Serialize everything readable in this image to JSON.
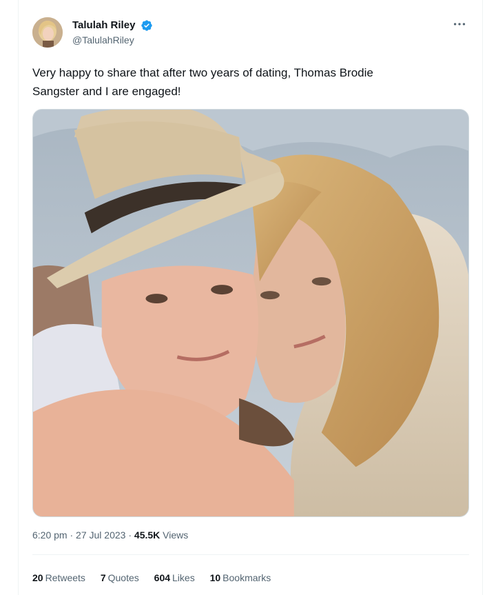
{
  "tweet": {
    "author": {
      "display_name": "Talulah Riley",
      "handle": "@TalulahRiley",
      "verified": true,
      "avatar_icon": "avatar-photo"
    },
    "more_icon": "more-options-icon",
    "text_line_1": "Very happy to share that after two years of dating, Thomas Brodie",
    "text_line_2": "Sangster and I are engaged!",
    "media": {
      "type": "photo",
      "description_icon": "couple-selfie-photo"
    },
    "meta": {
      "time": "6:20 pm",
      "separator_1": "·",
      "date": "27 Jul 2023",
      "separator_2": "·",
      "views_count": "45.5K",
      "views_label": "Views"
    },
    "stats": {
      "retweets_count": "20",
      "retweets_label": "Retweets",
      "quotes_count": "7",
      "quotes_label": "Quotes",
      "likes_count": "604",
      "likes_label": "Likes",
      "bookmarks_count": "10",
      "bookmarks_label": "Bookmarks"
    }
  },
  "colors": {
    "text_primary": "#0f1419",
    "text_secondary": "#536471",
    "verified_blue": "#1d9bf0",
    "border": "#eff3f4"
  }
}
